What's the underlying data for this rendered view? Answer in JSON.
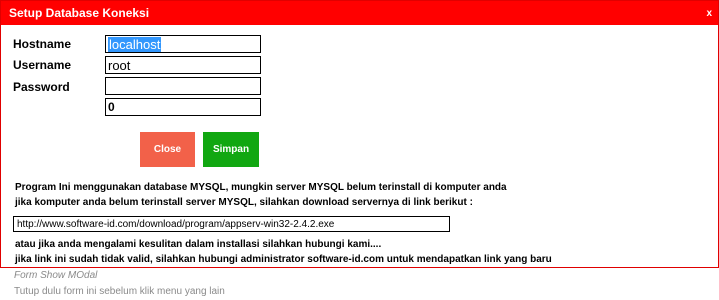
{
  "dialog": {
    "title": "Setup Database Koneksi",
    "close_glyph": "x",
    "accent_color": "#ff0000"
  },
  "form": {
    "hostname_label": "Hostname",
    "hostname_value": "localhost",
    "username_label": "Username",
    "username_value": "root",
    "password_label": "Password",
    "password_value": "",
    "port_value": "0"
  },
  "buttons": {
    "close_label": "Close",
    "save_label": "Simpan"
  },
  "info": {
    "line1": "Program Ini menggunakan database MYSQL, mungkin server MYSQL belum terinstall di komputer anda",
    "line2": "jika komputer anda belum terinstall server MYSQL, silahkan download servernya di link berikut :",
    "link": "http://www.software-id.com/download/program/appserv-win32-2.4.2.exe",
    "line3": "atau jika anda mengalami kesulitan dalam installasi silahkan hubungi kami....",
    "line4": "jika link ini sudah tidak valid, silahkan hubungi administrator software-id.com untuk mendapatkan link yang baru"
  },
  "status": {
    "caption": "Form Show MOdal",
    "message": "Tutup dulu form ini sebelum klik menu yang lain"
  }
}
